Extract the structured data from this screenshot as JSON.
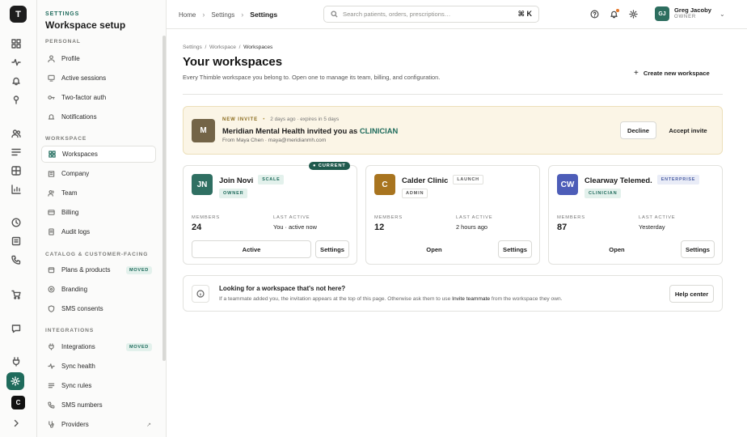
{
  "rail": {
    "logo": "T",
    "workspace_badge": "C"
  },
  "sidebar": {
    "eyebrow": "SETTINGS",
    "title": "Workspace setup",
    "sections": {
      "personal": "PERSONAL",
      "workspace": "WORKSPACE",
      "catalog": "CATALOG & CUSTOMER-FACING",
      "integrations": "INTEGRATIONS"
    },
    "items": {
      "profile": "Profile",
      "sessions": "Active sessions",
      "twofactor": "Two-factor auth",
      "notifications": "Notifications",
      "workspaces": "Workspaces",
      "company": "Company",
      "team": "Team",
      "billing": "Billing",
      "audit": "Audit logs",
      "plans": "Plans & products",
      "branding": "Branding",
      "sms_consents": "SMS consents",
      "integrations": "Integrations",
      "sync_health": "Sync health",
      "sync_rules": "Sync rules",
      "sms_numbers": "SMS numbers",
      "providers": "Providers"
    },
    "tag_moved": "MOVED",
    "external_glyph": "↗"
  },
  "topbar": {
    "breadcrumb": [
      "Home",
      "Settings",
      "Settings"
    ],
    "breadcrumb_sep": "›",
    "search_placeholder": "Search patients, orders, prescriptions…",
    "search_shortcut": "⌘ K",
    "user": {
      "initials": "GJ",
      "name": "Greg Jacoby",
      "role": "OWNER"
    }
  },
  "page": {
    "breadcrumb": [
      "Settings",
      "Workspace",
      "Workspaces"
    ],
    "breadcrumb_sep": "/",
    "title": "Your workspaces",
    "subtitle": "Every Thimble workspace you belong to. Open one to manage its team, billing, and configuration.",
    "create_plus": "+",
    "create_button": "Create new workspace"
  },
  "invite": {
    "initial": "M",
    "label": "NEW INVITE",
    "bullet": "•",
    "meta": "2 days ago · expires in 5 days",
    "title_prefix": "Meridian Mental Health invited you as",
    "role": "CLINICIAN",
    "from": "From Maya Chen · maya@meridianmh.com",
    "decline": "Decline",
    "accept": "Accept invite"
  },
  "labels": {
    "members": "MEMBERS",
    "last_active": "LAST ACTIVE",
    "settings": "Settings"
  },
  "workspaces": [
    {
      "initials": "JN",
      "name": "Join Novi",
      "plan": "SCALE",
      "role": "OWNER",
      "members": "24",
      "last_active": "You · active now",
      "action": "Active",
      "current": "● CURRENT",
      "color": "#2f6f62"
    },
    {
      "initials": "C",
      "name": "Calder Clinic",
      "plan": "LAUNCH",
      "role": "ADMIN",
      "members": "12",
      "last_active": "2 hours ago",
      "action": "Open",
      "color": "#a8741f"
    },
    {
      "initials": "CW",
      "name": "Clearway Telemed.",
      "plan": "ENTERPRISE",
      "role": "CLINICIAN",
      "members": "87",
      "last_active": "Yesterday",
      "action": "Open",
      "color": "#4d5db8"
    }
  ],
  "help": {
    "title": "Looking for a workspace that's not here?",
    "desc_before": "If a teammate added you, the invitation appears at the top of this page. Otherwise ask them to use",
    "desc_link": "Invite teammate",
    "desc_after": "from the workspace they own.",
    "button": "Help center"
  }
}
